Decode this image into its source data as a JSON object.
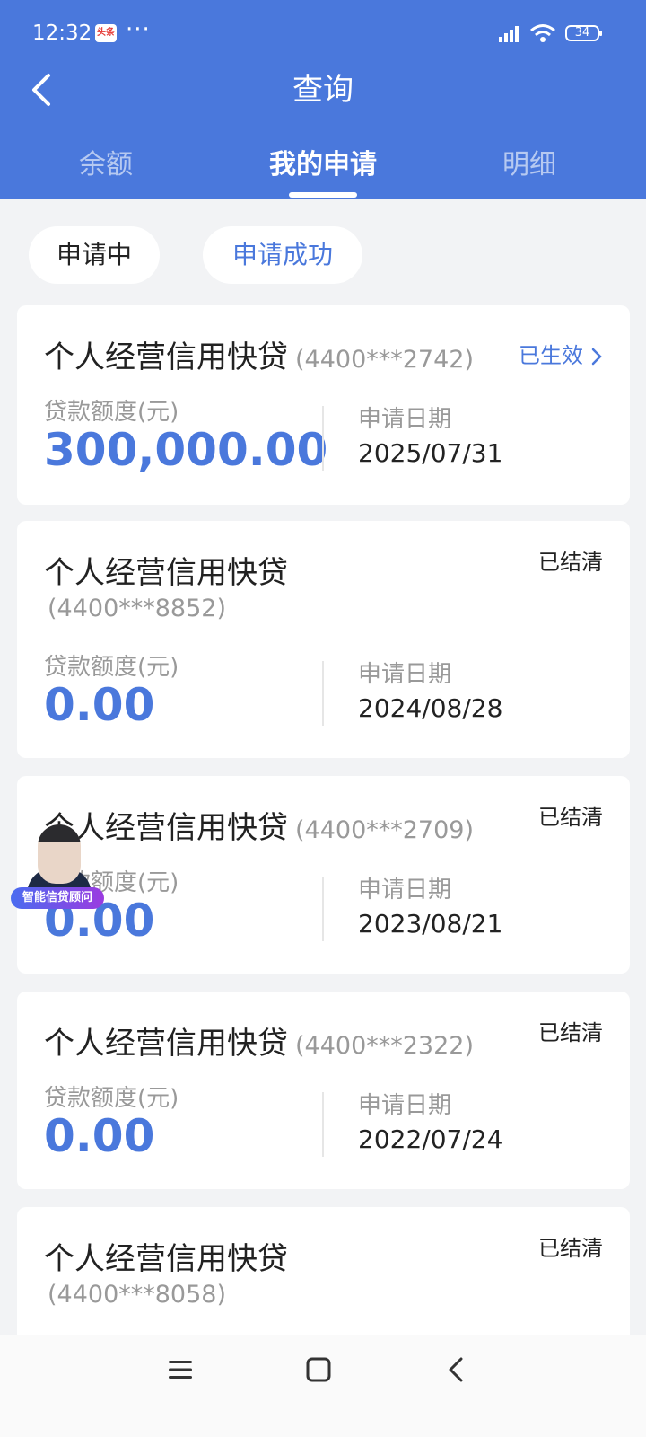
{
  "status_bar": {
    "time": "12:32",
    "news_badge": "头条",
    "dots": "···",
    "battery": "34"
  },
  "header": {
    "title": "查询"
  },
  "tabs": [
    {
      "label": "余额"
    },
    {
      "label": "我的申请"
    },
    {
      "label": "明细"
    }
  ],
  "filters": [
    {
      "label": "申请中"
    },
    {
      "label": "申请成功"
    }
  ],
  "labels": {
    "amount": "贷款额度(元)",
    "date": "申请日期"
  },
  "cards": [
    {
      "name": "个人经营信用快贷",
      "account": "(4400***2742)",
      "status": "已生效",
      "amount": "300,000.00",
      "date": "2025/07/31"
    },
    {
      "name": "个人经营信用快贷",
      "account": "(4400***8852)",
      "status": "已结清",
      "amount": "0.00",
      "date": "2024/08/28"
    },
    {
      "name": "个人经营信用快贷",
      "account": "(4400***2709)",
      "status": "已结清",
      "amount": "0.00",
      "date": "2023/08/21"
    },
    {
      "name": "个人经营信用快贷",
      "account": "(4400***2322)",
      "status": "已结清",
      "amount": "0.00",
      "date": "2022/07/24"
    },
    {
      "name": "个人经营信用快贷",
      "account": "(4400***8058)",
      "status": "已结清"
    }
  ],
  "assistant": {
    "label": "智能信贷顾问"
  },
  "colors": {
    "brand": "#4a78dc",
    "background": "#f2f3f5"
  }
}
